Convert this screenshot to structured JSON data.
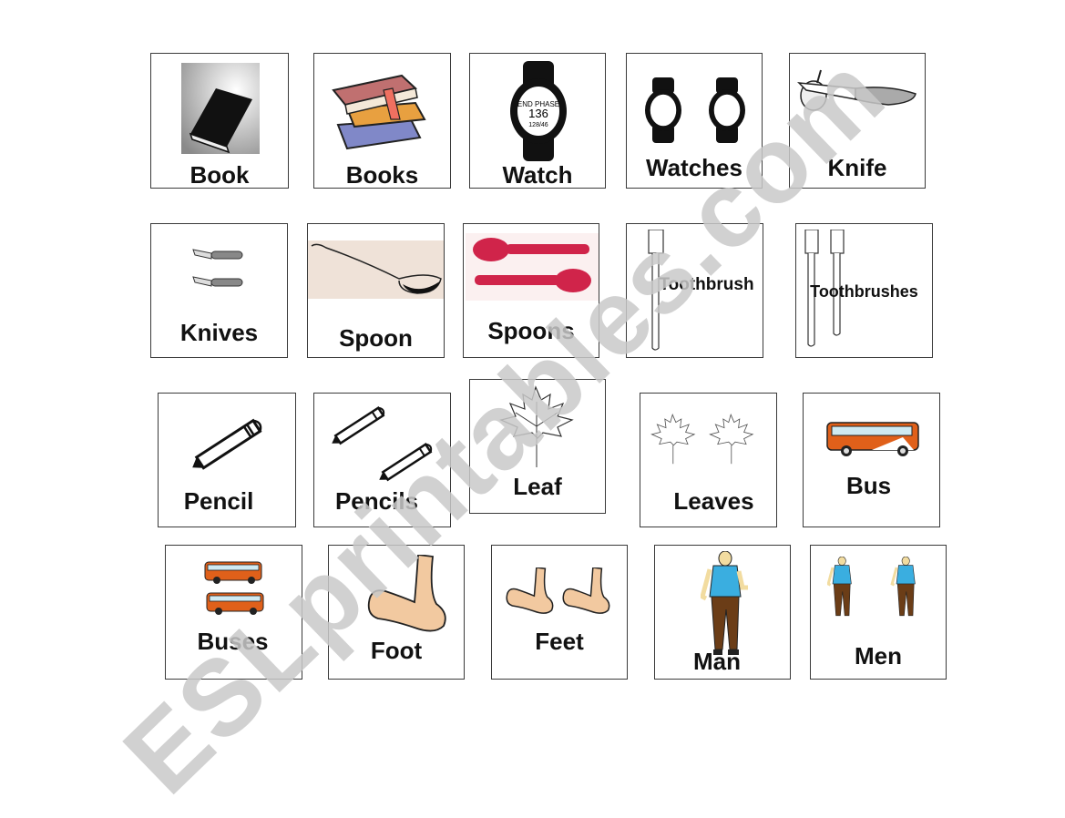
{
  "worksheet": {
    "watermark": "ESLprintables.com",
    "cards": [
      {
        "word": "Book",
        "picture": "book-icon"
      },
      {
        "word": "Books",
        "picture": "books-stack-icon"
      },
      {
        "word": "Watch",
        "picture": "wristwatch-icon"
      },
      {
        "word": "Watches",
        "picture": "wristwatches-icon"
      },
      {
        "word": "Knife",
        "picture": "knife-icon"
      },
      {
        "word": "Knives",
        "picture": "knives-icon"
      },
      {
        "word": "Spoon",
        "picture": "spoon-icon"
      },
      {
        "word": "Spoons",
        "picture": "spoons-icon"
      },
      {
        "word": "Toothbrush",
        "picture": "toothbrush-icon"
      },
      {
        "word": "Toothbrushes",
        "picture": "toothbrushes-icon"
      },
      {
        "word": "Pencil",
        "picture": "pencil-icon"
      },
      {
        "word": "Pencils",
        "picture": "pencils-icon"
      },
      {
        "word": "Leaf",
        "picture": "leaf-icon"
      },
      {
        "word": "Leaves",
        "picture": "leaves-icon"
      },
      {
        "word": "Bus",
        "picture": "bus-icon"
      },
      {
        "word": "Buses",
        "picture": "buses-icon"
      },
      {
        "word": "Foot",
        "picture": "foot-icon"
      },
      {
        "word": "Feet",
        "picture": "feet-icon"
      },
      {
        "word": "Man",
        "picture": "man-icon"
      },
      {
        "word": "Men",
        "picture": "men-icon"
      }
    ]
  },
  "colors": {
    "border": "#3a3a3a",
    "bus_orange": "#e0601a",
    "spoon_red": "#d0244a",
    "shirt_blue": "#3aaee0",
    "trousers_brown": "#6b3d17",
    "skin": "#f2c9a0",
    "watermark_gray": "#c9c9c9"
  }
}
